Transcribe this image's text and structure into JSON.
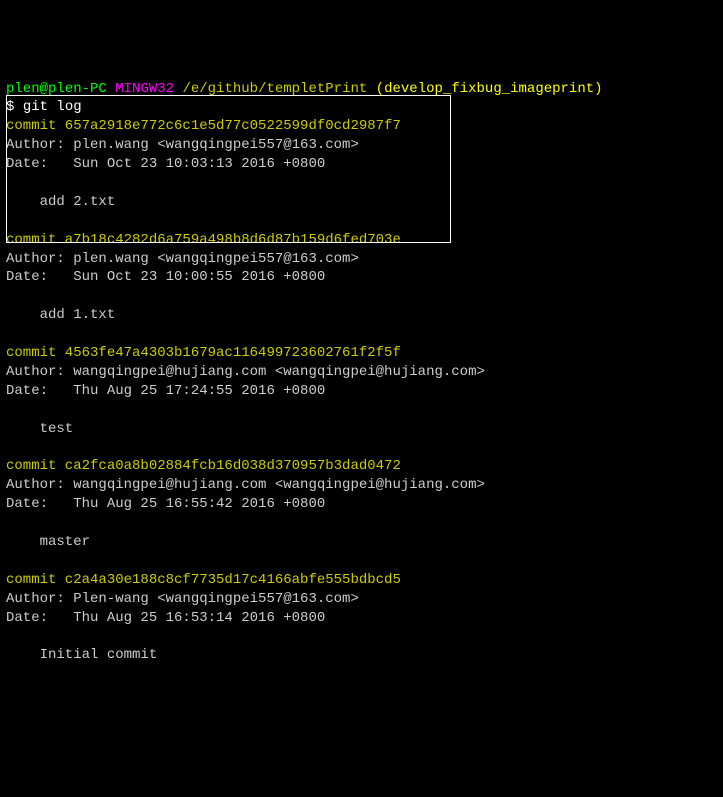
{
  "prompt": {
    "user": "plen@plen-PC",
    "shell": "MINGW32",
    "path": "/e/github/templetPrint",
    "branch": "(develop_fixbug_imageprint)",
    "dollar": "$ ",
    "command": "git log"
  },
  "commits": [
    {
      "hash": "commit 657a2918e772c6c1e5d77c0522599df0cd2987f7",
      "author": "Author: plen.wang <wangqingpei557@163.com>",
      "date": "Date:   Sun Oct 23 10:03:13 2016 +0800",
      "msg": "    add 2.txt"
    },
    {
      "hash": "commit a7b18c4282d6a759a498b8d6d87b159d6fed703e",
      "author": "Author: plen.wang <wangqingpei557@163.com>",
      "date": "Date:   Sun Oct 23 10:00:55 2016 +0800",
      "msg": "    add 1.txt"
    },
    {
      "hash": "commit 4563fe47a4303b1679ac116499723602761f2f5f",
      "author": "Author: wangqingpei@hujiang.com <wangqingpei@hujiang.com>",
      "date": "Date:   Thu Aug 25 17:24:55 2016 +0800",
      "msg": "    test"
    },
    {
      "hash": "commit ca2fca0a8b02884fcb16d038d370957b3dad0472",
      "author": "Author: wangqingpei@hujiang.com <wangqingpei@hujiang.com>",
      "date": "Date:   Thu Aug 25 16:55:42 2016 +0800",
      "msg": "    master"
    },
    {
      "hash": "commit c2a4a30e188c8cf7735d17c4166abfe555bdbcd5",
      "author": "Author: Plen-wang <wangqingpei557@163.com>",
      "date": "Date:   Thu Aug 25 16:53:14 2016 +0800",
      "msg": "    Initial commit"
    }
  ]
}
